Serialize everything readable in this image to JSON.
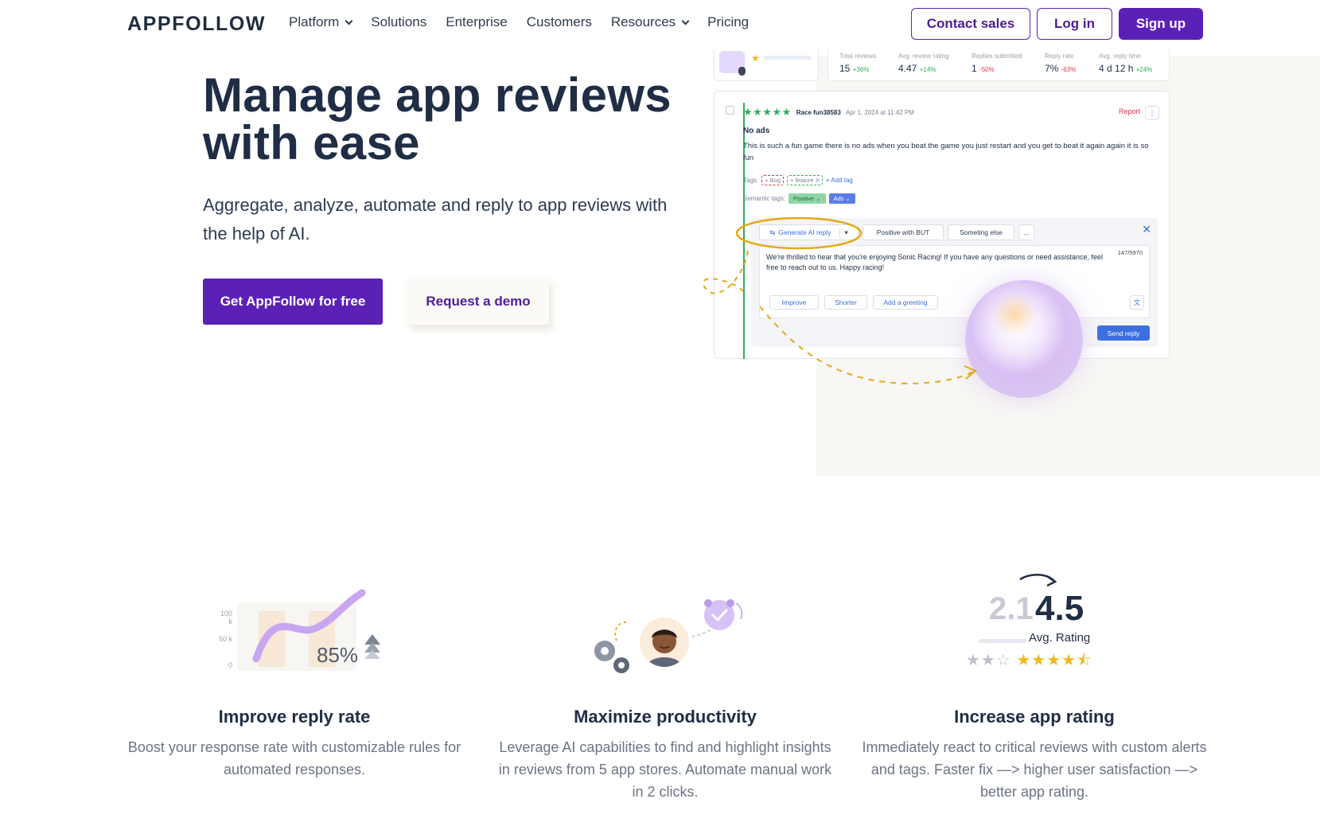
{
  "nav": {
    "logo": "APPFOLLOW",
    "links": [
      "Platform",
      "Solutions",
      "Enterprise",
      "Customers",
      "Resources",
      "Pricing"
    ],
    "contact_label": "Contact sales",
    "login_label": "Log in",
    "signup_label": "Sign up"
  },
  "hero": {
    "title": "Manage app reviews with ease",
    "subtitle": "Aggregate, analyze, automate and reply to app reviews with the help of AI.",
    "cta_primary": "Get AppFollow for free",
    "cta_secondary": "Request a demo"
  },
  "mockup": {
    "stats": [
      {
        "label": "Total reviews",
        "value": "15",
        "delta": "+36%",
        "trend": "up"
      },
      {
        "label": "Avg. review rating",
        "value": "4.47",
        "delta": "+14%",
        "trend": "up"
      },
      {
        "label": "Replies submitted",
        "value": "1",
        "delta": "-50%",
        "trend": "down"
      },
      {
        "label": "Reply rate",
        "value": "7%",
        "delta": "-63%",
        "trend": "down"
      },
      {
        "label": "Avg. reply time",
        "value": "4 d 12 h",
        "delta": "+24%",
        "trend": "up"
      }
    ],
    "review": {
      "author": "Race fun38583",
      "date": "Apr 1, 2024 at 11:42 PM",
      "report": "Report",
      "title": "No ads",
      "text": "This is such a fun game there is no ads when you beat the game you just restart and you get to beat it again again it is so fun",
      "tags_label": "Tags:",
      "tags": [
        "+ Bug",
        "+ feature X"
      ],
      "add_tag": "+ Add tag",
      "semantic_label": "Semantic tags:",
      "semantic_tags": [
        "Positive",
        "Ads"
      ]
    },
    "reply": {
      "generate": "Generate AI reply",
      "option1": "Positive with BUT",
      "option2": "Someting else",
      "more": "...",
      "counter": "147/5970",
      "text": "We're thrilled to hear that you're enjoying Sonic Racing! If you have any questions or need assistance, feel free to reach out to us. Happy racing!",
      "improve": "Improve",
      "shorter": "Shorter",
      "greeting": "Add a greeting",
      "send": "Send reply"
    }
  },
  "features": [
    {
      "title": "Improve reply rate",
      "desc": "Boost your response rate with customizable rules for automated responses."
    },
    {
      "title": "Maximize productivity",
      "desc": "Leverage AI capabilities to find and highlight insights in reviews from 5 app stores. Automate manual work in 2 clicks."
    },
    {
      "title": "Increase app rating",
      "desc": "Immediately react to critical reviews with custom alerts and tags. Faster fix —> higher user satisfaction —> better app rating."
    }
  ],
  "illustrations": {
    "reply_rate": {
      "percent": "85%",
      "axis": [
        "100 k",
        "50 k",
        "0"
      ]
    },
    "rating": {
      "old": "2.1",
      "new": "4.5",
      "label": "Avg. Rating",
      "old_stars": 2,
      "new_stars": 4.5
    }
  },
  "colors": {
    "brand": "#5b21b6",
    "accent_blue": "#3b6fe0",
    "gold": "#e5a819",
    "green": "#2fae5a",
    "red": "#e0344b"
  }
}
